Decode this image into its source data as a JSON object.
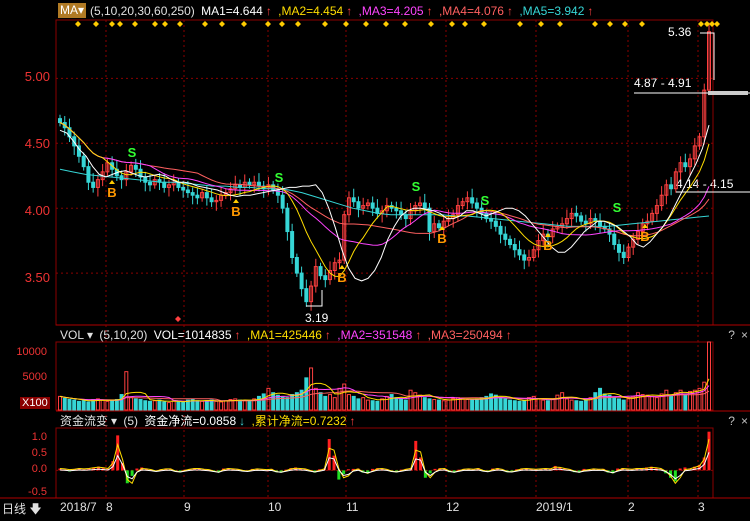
{
  "price_header": {
    "indicator": "MA",
    "params": "(5,10,20,30,60,250)",
    "ma1": {
      "label": "MA1=4.644",
      "color": "#ffffff"
    },
    "ma2": {
      "label": ",MA2=4.454",
      "color": "#ffdd00"
    },
    "ma3": {
      "label": ",MA3=4.205",
      "color": "#ff44ff"
    },
    "ma4": {
      "label": ",MA4=4.076",
      "color": "#ff6060"
    },
    "ma5": {
      "label": ",MA5=3.942",
      "color": "#36d6d6"
    }
  },
  "vol_header": {
    "indicator": "VOL",
    "params": "(5,10,20)",
    "vol": "VOL=1014835",
    "ma1": ",MA1=425446",
    "ma2": ",MA2=351548",
    "ma3": ",MA3=250494"
  },
  "flow_header": {
    "indicator": "资金流变",
    "params": "(5)",
    "net": "资金净流=0.0858",
    "cum": ",累计净流=0.7232"
  },
  "panel_controls": [
    "?",
    "×"
  ],
  "period_label": "日线",
  "colors": {
    "up": "#ff4040",
    "down": "#36d6d6",
    "axis_text": "#e33333",
    "grid": "#8b0000"
  },
  "chart_data": [
    {
      "type": "candlestick",
      "title": "",
      "y_ticks": [
        "5.00",
        "4.50",
        "4.00",
        "3.50"
      ],
      "ylim": [
        3.1,
        5.45
      ],
      "x_ticks": [
        "2018/7",
        "8",
        "9",
        "10",
        "11",
        "12",
        "2019/1",
        "2",
        "3"
      ],
      "annotations": {
        "high_label": "5.36",
        "low_label": "3.19",
        "range_top": "4.87 - 4.91",
        "range_mid": "4.14 - 4.15",
        "buy_marker": "B",
        "sell_marker": "S"
      },
      "series": [
        {
          "name": "MA1",
          "color": "#ffffff"
        },
        {
          "name": "MA2",
          "color": "#ffdd00"
        },
        {
          "name": "MA3",
          "color": "#ff44ff"
        },
        {
          "name": "MA4",
          "color": "#ff6060"
        },
        {
          "name": "MA5",
          "color": "#36d6d6"
        }
      ],
      "close": [
        4.66,
        4.62,
        4.55,
        4.48,
        4.4,
        4.32,
        4.2,
        4.16,
        4.22,
        4.28,
        4.35,
        4.3,
        4.25,
        4.22,
        4.28,
        4.33,
        4.3,
        4.24,
        4.2,
        4.18,
        4.22,
        4.2,
        4.16,
        4.18,
        4.2,
        4.16,
        4.14,
        4.12,
        4.1,
        4.08,
        4.12,
        4.08,
        4.05,
        4.06,
        4.1,
        4.12,
        4.15,
        4.18,
        4.16,
        4.2,
        4.18,
        4.2,
        4.17,
        4.15,
        4.18,
        4.14,
        4.1,
        4.0,
        3.82,
        3.62,
        3.5,
        3.38,
        3.28,
        3.4,
        3.55,
        3.48,
        3.45,
        3.52,
        3.58,
        3.6,
        3.95,
        4.08,
        4.05,
        4.0,
        4.02,
        4.04,
        4.0,
        3.96,
        3.98,
        4.02,
        4.0,
        3.98,
        3.95,
        3.92,
        3.98,
        4.02,
        4.04,
        4.0,
        3.82,
        3.88,
        3.85,
        3.9,
        3.92,
        3.95,
        4.02,
        4.05,
        4.08,
        4.04,
        4.0,
        3.96,
        3.92,
        3.9,
        3.86,
        3.8,
        3.76,
        3.72,
        3.68,
        3.64,
        3.6,
        3.62,
        3.68,
        3.75,
        3.8,
        3.78,
        3.84,
        3.86,
        3.88,
        3.92,
        3.96,
        3.94,
        3.9,
        3.88,
        3.92,
        3.9,
        3.86,
        3.84,
        3.8,
        3.72,
        3.66,
        3.62,
        3.7,
        3.76,
        3.82,
        3.88,
        3.9,
        3.96,
        4.02,
        4.1,
        4.18,
        4.15,
        4.28,
        4.35,
        4.32,
        4.38,
        4.48,
        4.55,
        4.91,
        5.36
      ],
      "ma_values": {
        "MA1": [
          4.6,
          4.58,
          4.52,
          4.45,
          4.4,
          4.32,
          4.26,
          4.24,
          4.26,
          4.28,
          4.29,
          4.27,
          4.25,
          4.24,
          4.25,
          4.26,
          4.25,
          4.22,
          4.2,
          4.2,
          4.19,
          4.17,
          4.16,
          4.15,
          4.14,
          4.12,
          4.1,
          4.09,
          4.1,
          4.1,
          4.11,
          4.12,
          4.13,
          4.14,
          4.15,
          4.16,
          4.16,
          4.17,
          4.17,
          4.18,
          4.12,
          4.0,
          3.85,
          3.68,
          3.54,
          3.46,
          3.44,
          3.46,
          3.52,
          3.62,
          3.76,
          3.86,
          3.94,
          3.98,
          4.0,
          4.0,
          3.99,
          3.98,
          3.96,
          3.92,
          3.92,
          3.94,
          3.98,
          3.98,
          3.96,
          3.94,
          3.96,
          3.98,
          4.0,
          4.0,
          3.98,
          3.94,
          3.88,
          3.82,
          3.76,
          3.7,
          3.66,
          3.66,
          3.7,
          3.76,
          3.82,
          3.86,
          3.9,
          3.9,
          3.88,
          3.86,
          3.82,
          3.78,
          3.72,
          3.7,
          3.74,
          3.8,
          3.86,
          3.94,
          4.04,
          4.14,
          4.24,
          4.34,
          4.46,
          4.64
        ],
        "MA5": [
          4.3,
          4.28,
          4.26,
          4.25,
          4.24,
          4.23,
          4.22,
          4.21,
          4.2,
          4.2,
          4.19,
          4.18,
          4.17,
          4.17,
          4.16,
          4.16,
          4.15,
          4.15,
          4.14,
          4.12,
          4.09,
          4.06,
          4.03,
          4.0,
          3.98,
          3.96,
          3.95,
          3.95,
          3.95,
          3.95,
          3.95,
          3.94,
          3.94,
          3.93,
          3.92,
          3.91,
          3.9,
          3.89,
          3.88,
          3.87,
          3.86,
          3.86,
          3.86,
          3.86,
          3.87,
          3.88,
          3.89,
          3.9,
          3.91,
          3.92,
          3.93,
          3.94
        ]
      }
    },
    {
      "type": "bar",
      "title": "",
      "y_ticks": [
        "10000",
        "5000"
      ],
      "y_unit_label": "X100",
      "ylim": [
        0,
        11000
      ],
      "values": [
        2200,
        1900,
        1700,
        1600,
        1400,
        1500,
        1300,
        1700,
        1800,
        1600,
        1400,
        1500,
        1700,
        2500,
        6200,
        2000,
        1800,
        1700,
        1500,
        1400,
        1500,
        1600,
        1300,
        1200,
        1500,
        1400,
        1300,
        1600,
        1700,
        1500,
        1400,
        1500,
        1600,
        1400,
        1300,
        1500,
        1700,
        1800,
        1600,
        1500,
        1400,
        1800,
        2200,
        2600,
        3500,
        2800,
        2400,
        2200,
        2000,
        2500,
        2800,
        3200,
        5200,
        6800,
        3500,
        2800,
        2200,
        2500,
        2000,
        3500,
        4200,
        2500,
        2200,
        1800,
        2000,
        1600,
        1500,
        1400,
        1800,
        2200,
        2500,
        2000,
        1800,
        1600,
        3200,
        2800,
        2400,
        2000,
        1800,
        1700,
        1600,
        1500,
        1600,
        1800,
        2000,
        1800,
        1700,
        1600,
        1800,
        2000,
        2200,
        2600,
        2400,
        2000,
        1800,
        1600,
        1500,
        1400,
        1500,
        2000,
        2200,
        1800,
        1600,
        1500,
        1800,
        2400,
        2800,
        1800,
        1600,
        1500,
        1400,
        1800,
        2000,
        2800,
        3500,
        2600,
        2400,
        2000,
        1800,
        1600,
        1800,
        2200,
        2800,
        2500,
        2400,
        2200,
        2000,
        2600,
        3200,
        2400,
        2800,
        3200,
        2600,
        3000,
        3200,
        3500,
        4500,
        11000
      ]
    },
    {
      "type": "bar",
      "title": "",
      "y_ticks": [
        "1.0",
        "0.5",
        "0.0",
        "-0.5"
      ],
      "ylim": [
        -0.75,
        1.15
      ],
      "values": [
        0.05,
        0.02,
        -0.03,
        0.04,
        0.06,
        0.03,
        0.05,
        0.08,
        0.1,
        0.06,
        0.04,
        0.25,
        0.95,
        0.2,
        -0.35,
        -0.15,
        0.05,
        0.08,
        0.04,
        0.02,
        -0.02,
        0.03,
        0.05,
        0.04,
        -0.03,
        -0.05,
        0.02,
        0.04,
        0.06,
        0.05,
        0.03,
        0.02,
        -0.04,
        -0.06,
        0.05,
        0.06,
        0.04,
        0.03,
        -0.02,
        -0.03,
        0.04,
        0.05,
        0.03,
        0.02,
        0.04,
        -0.05,
        -0.06,
        0.02,
        0.06,
        0.08,
        0.05,
        0.04,
        -0.03,
        -0.06,
        0.03,
        0.05,
        0.85,
        0.4,
        -0.25,
        -0.1,
        0.03,
        0.04,
        0.05,
        -0.06,
        -0.08,
        0.04,
        0.06,
        0.05,
        0.03,
        -0.04,
        -0.05,
        0.02,
        0.04,
        0.06,
        0.8,
        0.35,
        -0.2,
        -0.08,
        0.04,
        0.06,
        0.05,
        -0.05,
        -0.06,
        0.02,
        0.04,
        0.05,
        0.03,
        0.06,
        -0.03,
        -0.04,
        0.05,
        0.06,
        0.02,
        -0.05,
        -0.04,
        0.03,
        0.05,
        0.06,
        0.04,
        0.03,
        0.05,
        0.06,
        0.04,
        0.12,
        0.08,
        0.05,
        0.03,
        -0.05,
        -0.06,
        0.04,
        0.02,
        0.05,
        0.03,
        0.04,
        -0.06,
        -0.08,
        0.05,
        0.06,
        0.03,
        0.04,
        0.06,
        0.05,
        0.08,
        0.1,
        0.06,
        0.04,
        -0.08,
        -0.2,
        -0.3,
        0.05,
        0.08,
        0.04,
        0.1,
        0.15,
        0.35,
        1.05
      ],
      "line": [
        0.05,
        0.04,
        0.02,
        0.03,
        0.05,
        0.04,
        0.05,
        0.07,
        0.09,
        0.07,
        0.05,
        0.2,
        0.7,
        0.3,
        -0.25,
        -0.35,
        -0.05,
        0.05,
        0.04,
        0.02,
        -0.02,
        0.02,
        0.04,
        0.04,
        -0.02,
        -0.04,
        0.0,
        0.03,
        0.05,
        0.05,
        0.03,
        0.02,
        -0.02,
        -0.05,
        0.02,
        0.05,
        0.04,
        0.03,
        0.0,
        -0.02,
        0.02,
        0.04,
        0.03,
        0.02,
        0.03,
        -0.03,
        -0.05,
        -0.01,
        0.04,
        0.06,
        0.05,
        0.04,
        0.0,
        -0.04,
        0.0,
        0.04,
        0.6,
        0.55,
        0.05,
        -0.2,
        -0.15,
        0.0,
        0.04,
        -0.04,
        -0.08,
        -0.02,
        0.04,
        0.05,
        0.03,
        -0.02,
        -0.04,
        -0.01,
        0.03,
        0.05,
        0.55,
        0.5,
        -0.05,
        -0.2,
        -0.05,
        0.04,
        0.05,
        -0.02,
        -0.05,
        -0.01,
        0.03,
        0.04,
        0.03,
        0.05,
        0.0,
        -0.03,
        0.02,
        0.05,
        0.03,
        -0.03,
        -0.04,
        0.0,
        0.04,
        0.05,
        0.04,
        0.03,
        0.04,
        0.05,
        0.04,
        0.09,
        0.08,
        0.05,
        0.03,
        -0.02,
        -0.05,
        0.0,
        0.02,
        0.04,
        0.03,
        0.03,
        -0.03,
        -0.07,
        0.0,
        0.05,
        0.04,
        0.03,
        0.05,
        0.05,
        0.06,
        0.08,
        0.07,
        0.05,
        -0.02,
        -0.15,
        -0.35,
        -0.2,
        0.02,
        0.04,
        0.08,
        0.12,
        0.3,
        0.85
      ]
    }
  ]
}
